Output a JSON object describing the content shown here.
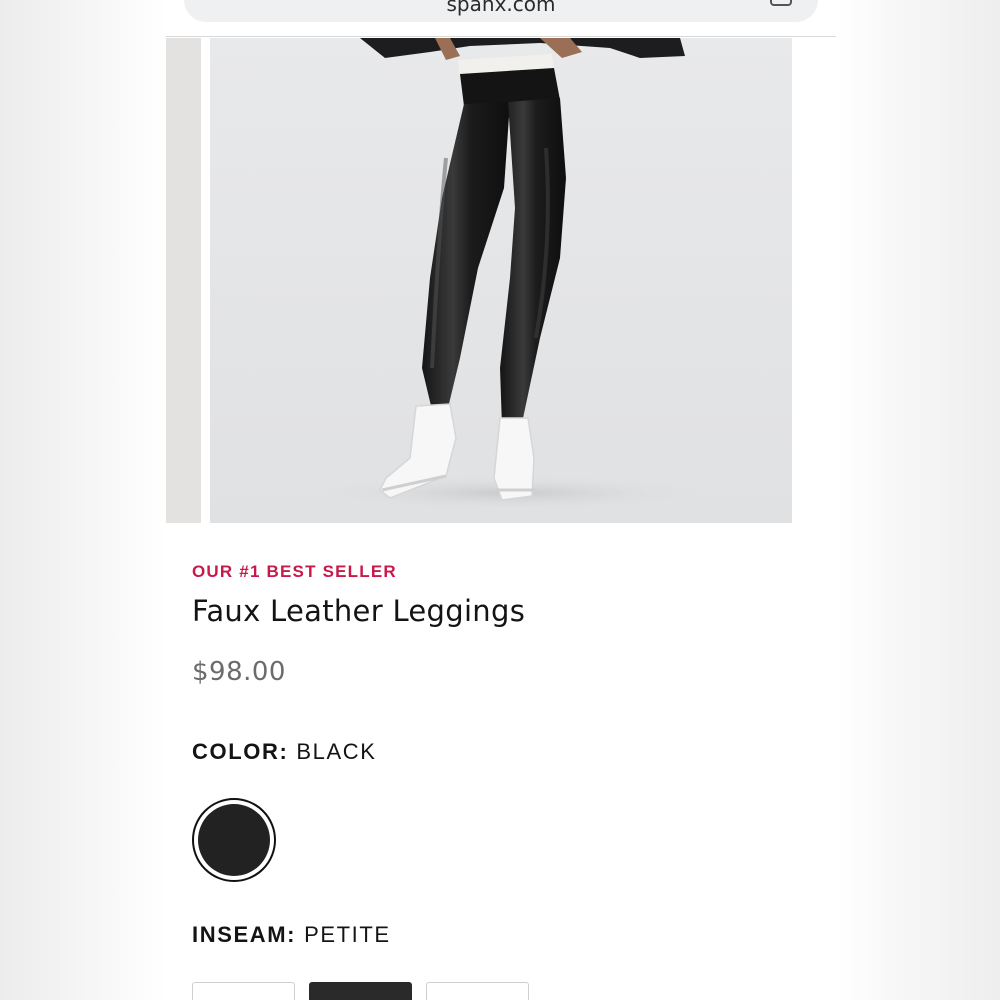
{
  "browser": {
    "url": "spanx.com"
  },
  "product": {
    "tagline": "OUR #1 BEST SELLER",
    "title": "Faux Leather Leggings",
    "price": "$98.00"
  },
  "color": {
    "label": "COLOR:",
    "value": "BLACK",
    "swatches": [
      {
        "name": "Black",
        "hex": "#222222",
        "selected": true
      }
    ]
  },
  "inseam": {
    "label": "INSEAM:",
    "value": "PETITE",
    "options": [
      {
        "label": "",
        "selected": false
      },
      {
        "label": "",
        "selected": true
      },
      {
        "label": "",
        "selected": false
      }
    ]
  },
  "colors": {
    "accent": "#c8194b",
    "text": "#141414",
    "price": "#6b6b6b"
  }
}
